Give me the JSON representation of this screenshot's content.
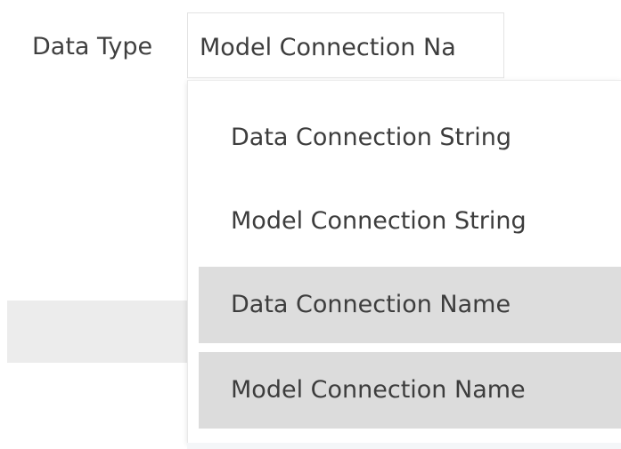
{
  "form": {
    "label": "Data Type",
    "selected_value": "Model Connection Na"
  },
  "dropdown": {
    "options": [
      {
        "label": "Data Connection String"
      },
      {
        "label": "Model Connection String"
      },
      {
        "label": "Data Connection Name"
      },
      {
        "label": "Model Connection Name"
      }
    ]
  },
  "colors": {
    "text": "#3d3d3d",
    "highlight": "#dddddd",
    "border": "#e3e3e3"
  }
}
